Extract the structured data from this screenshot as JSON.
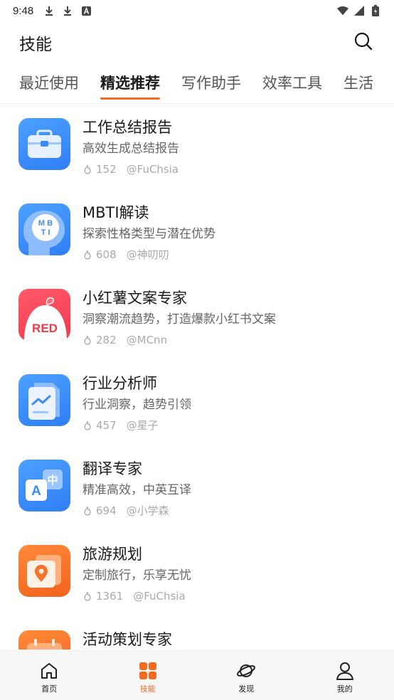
{
  "status_bar": {
    "time": "9:48",
    "left_icons": [
      "download-icon",
      "download-icon",
      "a-text-icon"
    ],
    "right_icons": [
      "wifi-icon",
      "cellular-icon",
      "battery-icon"
    ]
  },
  "header": {
    "title": "技能",
    "search_icon": "search-icon"
  },
  "tabs": [
    {
      "label": "最近使用",
      "active": false
    },
    {
      "label": "精选推荐",
      "active": true
    },
    {
      "label": "写作助手",
      "active": false
    },
    {
      "label": "效率工具",
      "active": false
    },
    {
      "label": "生活",
      "active": false
    }
  ],
  "colors": {
    "accent": "#f26b22",
    "icon_blue": "#3b8cf8",
    "icon_red": "#f5485a",
    "icon_orange": "#f5722a"
  },
  "skills": [
    {
      "title": "工作总结报告",
      "desc": "高效生成总结报告",
      "count": "152",
      "author": "@FuChsia",
      "icon": "briefcase-icon"
    },
    {
      "title": "MBTI解读",
      "desc": "探索性格类型与潜在优势",
      "count": "608",
      "author": "@神叨叨",
      "icon": "head-mbti-icon",
      "icon_text": "M B\nT I"
    },
    {
      "title": "小红薯文案专家",
      "desc": "洞察潮流趋势，打造爆款小红书文案",
      "count": "282",
      "author": "@MCnn",
      "icon": "red-sweet-potato-icon",
      "icon_text": "RED"
    },
    {
      "title": "行业分析师",
      "desc": "行业洞察，趋势引领",
      "count": "457",
      "author": "@星子",
      "icon": "document-chart-icon"
    },
    {
      "title": "翻译专家",
      "desc": "精准高效，中英互译",
      "count": "694",
      "author": "@小学森",
      "icon": "translate-icon",
      "icon_text_a": "A",
      "icon_text_zh": "中"
    },
    {
      "title": "旅游规划",
      "desc": "定制旅行，乐享无忧",
      "count": "1361",
      "author": "@FuChsia",
      "icon": "map-pin-icon"
    },
    {
      "title": "活动策划专家",
      "desc": "",
      "count": "",
      "author": "",
      "icon": "calendar-icon"
    }
  ],
  "bottom_nav": [
    {
      "label": "首页",
      "icon": "home-icon",
      "active": false
    },
    {
      "label": "技能",
      "icon": "grid-icon",
      "active": true
    },
    {
      "label": "发现",
      "icon": "planet-icon",
      "active": false
    },
    {
      "label": "我的",
      "icon": "person-icon",
      "active": false
    }
  ]
}
